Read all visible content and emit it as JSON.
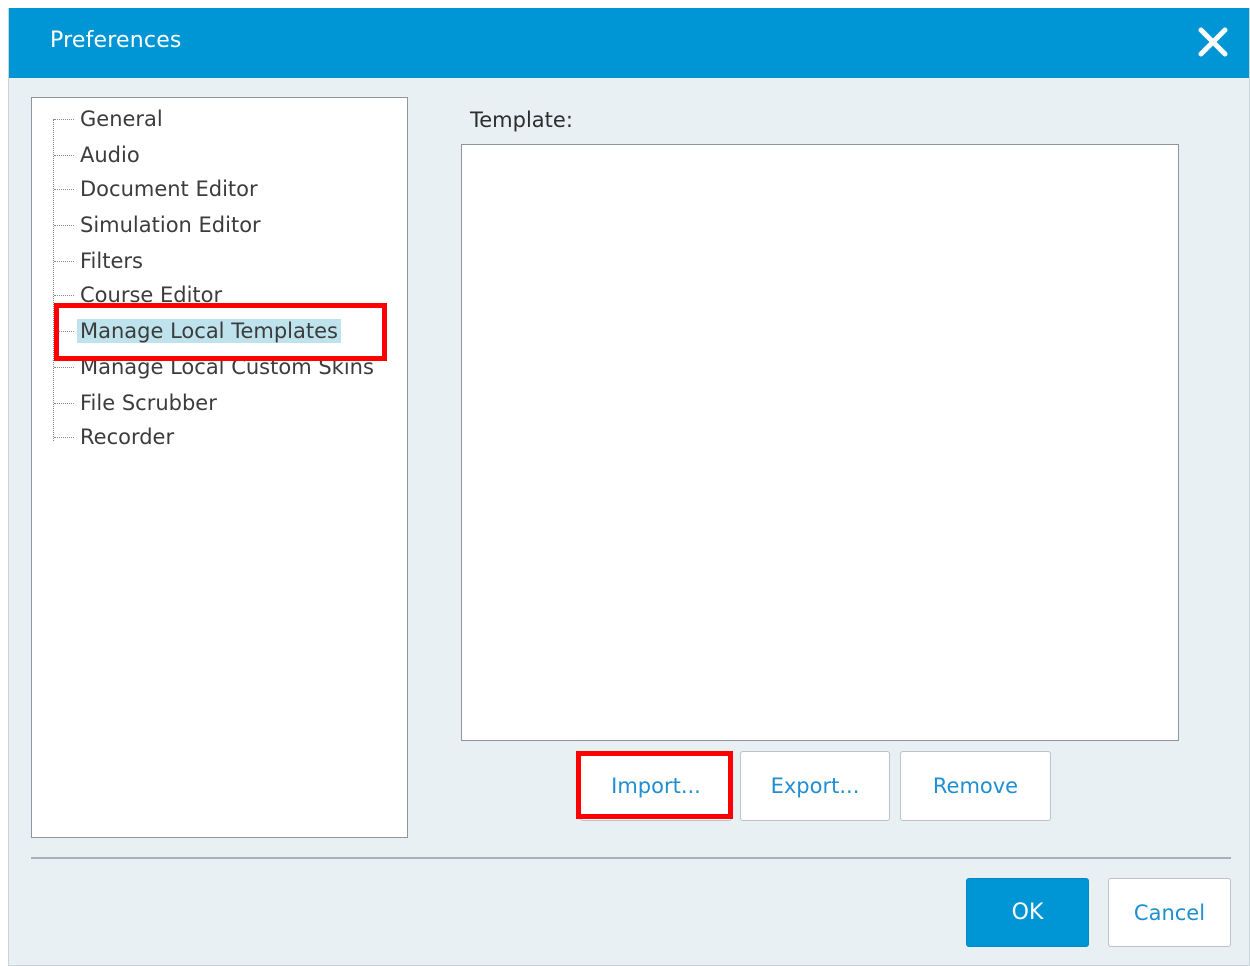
{
  "window": {
    "title": "Preferences",
    "close_icon": "close-icon"
  },
  "sidebar": {
    "items": [
      {
        "label": "General"
      },
      {
        "label": "Audio"
      },
      {
        "label": "Document Editor"
      },
      {
        "label": "Simulation Editor"
      },
      {
        "label": "Filters"
      },
      {
        "label": "Course Editor"
      },
      {
        "label": "Manage Local Templates",
        "selected": true
      },
      {
        "label": "Manage Local Custom Skins"
      },
      {
        "label": "File Scrubber"
      },
      {
        "label": "Recorder"
      }
    ]
  },
  "main": {
    "template_label": "Template:",
    "import_label": "Import...",
    "export_label": "Export...",
    "remove_label": "Remove"
  },
  "footer": {
    "ok_label": "OK",
    "cancel_label": "Cancel"
  },
  "colors": {
    "titlebar": "#0095d5",
    "accent_text": "#1f8fd1",
    "selection": "#bfe3ec",
    "highlight": "#ff0000"
  }
}
